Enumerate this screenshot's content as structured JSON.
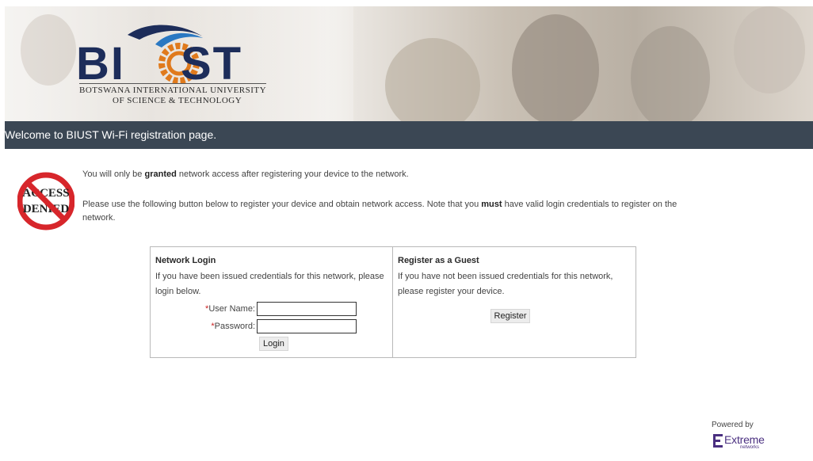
{
  "header": {
    "logo_letters": "BI  ST",
    "logo_subtitle_1": "BOTSWANA INTERNATIONAL UNIVERSITY",
    "logo_subtitle_2": "OF SCIENCE & TECHNOLOGY",
    "colors": {
      "logo_navy": "#1d2d5a",
      "gear_orange": "#e07a1c",
      "titlebar_bg": "#3b4754"
    }
  },
  "title_bar": {
    "text": "Welcome to BIUST Wi-Fi registration page."
  },
  "access_denied": {
    "icon": "access-denied-icon",
    "line1": "ACCESS",
    "line2": "DENIED"
  },
  "messages": {
    "line1_pre": "You will only be ",
    "line1_bold": "granted",
    "line1_post": " network access after registering your device to the network.",
    "line2_pre": "Please use the following button below to register your device and obtain network access. Note that you ",
    "line2_bold": "must",
    "line2_post": " have valid login credentials to register on the network."
  },
  "network_login": {
    "heading": "Network Login",
    "description": "If you have been issued credentials for this network, please login below.",
    "required_mark": "*",
    "username_label": "User Name:",
    "username_value": "",
    "password_label": "Password:",
    "password_value": "",
    "login_button": "Login"
  },
  "guest": {
    "heading": "Register as a Guest",
    "description": "If you have not been issued credentials for this network, please register your device.",
    "register_button": "Register"
  },
  "footer": {
    "powered_by": "Powered by",
    "brand": "Extreme",
    "brand_sub": "networks",
    "brand_color": "#4a2f80"
  }
}
